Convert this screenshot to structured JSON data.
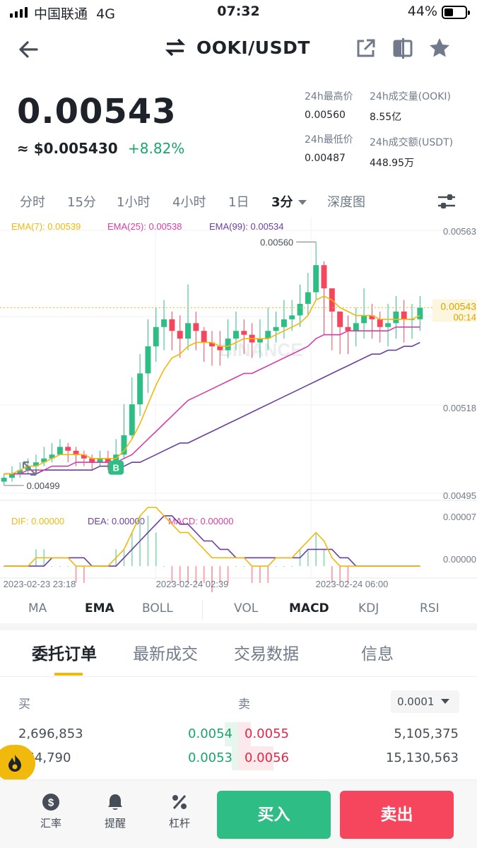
{
  "status_bar": {
    "carrier": "中国联通",
    "network": "4G",
    "time": "07:32",
    "battery": "44%",
    "battery_level": 0.44
  },
  "header": {
    "pair": "OOKI/USDT",
    "icons": [
      "back-arrow-icon",
      "swap-icon",
      "share-icon",
      "split-icon",
      "star-icon"
    ]
  },
  "price": {
    "last": "0.00543",
    "usd": "≈ $0.005430",
    "change": "+8.82%"
  },
  "stats": {
    "high_label": "24h最高价",
    "high": "0.00560",
    "low_label": "24h最低价",
    "low": "0.00487",
    "vol_label": "24h成交量(OOKI)",
    "vol": "8.55亿",
    "amount_label": "24h成交额(USDT)",
    "amount": "448.95万"
  },
  "timeframes": [
    "分时",
    "15分",
    "1小时",
    "4小时",
    "1日",
    "3分",
    "深度图"
  ],
  "active_timeframe": "3分",
  "indicator_tabs": {
    "main": [
      "MA",
      "EMA",
      "BOLL"
    ],
    "sub": [
      "VOL",
      "MACD",
      "KDJ",
      "RSI"
    ],
    "active_main": "EMA",
    "active_sub": "MACD"
  },
  "book_tabs": [
    "委托订单",
    "最新成交",
    "交易数据",
    "信息"
  ],
  "order_book": {
    "buy_label": "买",
    "sell_label": "卖",
    "precision": "0.0001",
    "rows": [
      {
        "buy_qty": "2,696,853",
        "buy_price": "0.0054",
        "sell_price": "0.0055",
        "sell_qty": "5,105,375"
      },
      {
        "buy_qty": "864,790",
        "buy_price": "0.0053",
        "sell_price": "0.0056",
        "sell_qty": "15,130,563"
      }
    ]
  },
  "bottom_nav": [
    {
      "label": "汇率",
      "icon": "dollar-icon"
    },
    {
      "label": "提醒",
      "icon": "bell-icon"
    },
    {
      "label": "杠杆",
      "icon": "percent-icon"
    }
  ],
  "actions": {
    "buy": "买入",
    "sell": "卖出"
  },
  "colors": {
    "up": "#2ebd85",
    "down": "#f6465d",
    "ema7": "#f0b90b",
    "ema25": "#d63ea8",
    "ema99": "#6b3fa0",
    "accent": "#f0b90b"
  },
  "chart_data": {
    "type": "candlestick",
    "ema_legend": [
      "EMA(7): 0.00539",
      "EMA(25): 0.00538",
      "EMA(99): 0.00534"
    ],
    "price_axis": [
      "0.00563",
      "0.00518",
      "0.00495"
    ],
    "last_price_tag": "0.00543",
    "countdown": "00:14",
    "high_marker": "0.00560",
    "low_marker": "0.00499",
    "buy_marker": "B",
    "macd_legend": [
      "DIF: 0.00000",
      "DEA: 0.00000",
      "MACD: 0.00000"
    ],
    "macd_axis": [
      "0.00007",
      "0.00000"
    ],
    "time_axis": [
      "2023-02-23 23:18",
      "2023-02-24 02:39",
      "2023-02-24 06:00"
    ],
    "ylim": [
      0.00495,
      0.00563
    ],
    "close": [
      0.00499,
      0.005,
      0.00501,
      0.00502,
      0.00503,
      0.00504,
      0.00505,
      0.00507,
      0.00506,
      0.00505,
      0.00504,
      0.00503,
      0.00504,
      0.00503,
      0.00505,
      0.0051,
      0.00518,
      0.00526,
      0.00533,
      0.00538,
      0.0054,
      0.00537,
      0.00535,
      0.00539,
      0.00537,
      0.00534,
      0.00533,
      0.00532,
      0.00535,
      0.00537,
      0.00536,
      0.00534,
      0.00535,
      0.00537,
      0.00538,
      0.0054,
      0.00541,
      0.00544,
      0.00547,
      0.00554,
      0.00548,
      0.00542,
      0.00538,
      0.00537,
      0.00539,
      0.00541,
      0.0054,
      0.00538,
      0.00539,
      0.00542,
      0.0054,
      0.0054,
      0.00543
    ],
    "high": [
      0.005,
      0.00502,
      0.00503,
      0.00504,
      0.00505,
      0.00507,
      0.00508,
      0.00509,
      0.00508,
      0.00507,
      0.00506,
      0.00505,
      0.00506,
      0.00506,
      0.00509,
      0.00518,
      0.00525,
      0.00531,
      0.0054,
      0.00543,
      0.00545,
      0.00542,
      0.00541,
      0.00549,
      0.00542,
      0.00538,
      0.00537,
      0.00537,
      0.0054,
      0.00542,
      0.0054,
      0.00539,
      0.0054,
      0.00543,
      0.00542,
      0.00545,
      0.00545,
      0.00549,
      0.00552,
      0.0056,
      0.00555,
      0.00546,
      0.00542,
      0.00541,
      0.00543,
      0.00548,
      0.00544,
      0.00542,
      0.00544,
      0.00546,
      0.00545,
      0.00544,
      0.00546
    ],
    "low": [
      0.00497,
      0.00498,
      0.00499,
      0.005,
      0.00501,
      0.00502,
      0.00503,
      0.00505,
      0.00503,
      0.00502,
      0.00502,
      0.00501,
      0.00502,
      0.00501,
      0.00502,
      0.00504,
      0.00509,
      0.00515,
      0.00521,
      0.00529,
      0.00532,
      0.00532,
      0.0053,
      0.00532,
      0.00532,
      0.00529,
      0.00528,
      0.00528,
      0.0053,
      0.00532,
      0.00531,
      0.0053,
      0.0053,
      0.00532,
      0.00534,
      0.00535,
      0.00537,
      0.00538,
      0.00541,
      0.00545,
      0.00536,
      0.00532,
      0.00531,
      0.00531,
      0.00533,
      0.00535,
      0.00535,
      0.00534,
      0.00533,
      0.00535,
      0.00534,
      0.00535,
      0.00537
    ],
    "ema7": [
      0.005,
      0.005,
      0.00501,
      0.00502,
      0.00502,
      0.00503,
      0.00504,
      0.00505,
      0.00505,
      0.00505,
      0.00505,
      0.00504,
      0.00504,
      0.00504,
      0.00504,
      0.00506,
      0.00509,
      0.00513,
      0.00518,
      0.00523,
      0.00527,
      0.0053,
      0.00531,
      0.00533,
      0.00534,
      0.00534,
      0.00534,
      0.00533,
      0.00533,
      0.00534,
      0.00535,
      0.00535,
      0.00535,
      0.00535,
      0.00536,
      0.00537,
      0.00538,
      0.00539,
      0.00541,
      0.00545,
      0.00546,
      0.00545,
      0.00543,
      0.00542,
      0.00541,
      0.00541,
      0.00541,
      0.0054,
      0.0054,
      0.0054,
      0.0054,
      0.0054,
      0.00541
    ],
    "ema25": [
      0.005,
      0.005,
      0.005,
      0.00501,
      0.00501,
      0.00501,
      0.00502,
      0.00502,
      0.00502,
      0.00503,
      0.00503,
      0.00503,
      0.00503,
      0.00503,
      0.00503,
      0.00504,
      0.00505,
      0.00507,
      0.00509,
      0.00511,
      0.00513,
      0.00515,
      0.00517,
      0.00519,
      0.0052,
      0.00521,
      0.00522,
      0.00523,
      0.00524,
      0.00525,
      0.00526,
      0.00526,
      0.00527,
      0.00528,
      0.00529,
      0.0053,
      0.00531,
      0.00532,
      0.00533,
      0.00535,
      0.00536,
      0.00536,
      0.00536,
      0.00537,
      0.00537,
      0.00537,
      0.00537,
      0.00537,
      0.00537,
      0.00538,
      0.00538,
      0.00538,
      0.00538
    ],
    "ema99": [
      0.005,
      0.005,
      0.005,
      0.005,
      0.005,
      0.00501,
      0.00501,
      0.00501,
      0.00501,
      0.00501,
      0.00501,
      0.00501,
      0.00502,
      0.00502,
      0.00502,
      0.00502,
      0.00503,
      0.00503,
      0.00504,
      0.00505,
      0.00506,
      0.00507,
      0.00508,
      0.00508,
      0.00509,
      0.0051,
      0.00511,
      0.00512,
      0.00513,
      0.00514,
      0.00515,
      0.00516,
      0.00517,
      0.00518,
      0.00519,
      0.0052,
      0.00521,
      0.00522,
      0.00523,
      0.00524,
      0.00525,
      0.00526,
      0.00527,
      0.00528,
      0.00529,
      0.0053,
      0.00531,
      0.00531,
      0.00532,
      0.00532,
      0.00533,
      0.00533,
      0.00534
    ],
    "dif": [
      0.0,
      0.0,
      0.0,
      0.0,
      1e-05,
      1e-05,
      1e-05,
      1e-05,
      1e-05,
      0.0,
      0.0,
      0.0,
      0.0,
      0.0,
      1e-05,
      2e-05,
      4e-05,
      6e-05,
      7e-05,
      7e-05,
      6e-05,
      5e-05,
      4e-05,
      4e-05,
      3e-05,
      2e-05,
      1e-05,
      1e-05,
      1e-05,
      1e-05,
      1e-05,
      0.0,
      0.0,
      0.0,
      1e-05,
      1e-05,
      1e-05,
      2e-05,
      3e-05,
      4e-05,
      3e-05,
      1e-05,
      0.0,
      0.0,
      0.0,
      0.0,
      0.0,
      0.0,
      0.0,
      0.0,
      0.0,
      0.0,
      0.0
    ],
    "dea": [
      0.0,
      0.0,
      0.0,
      0.0,
      0.0,
      0.0,
      1e-05,
      1e-05,
      1e-05,
      1e-05,
      1e-05,
      0.0,
      0.0,
      0.0,
      0.0,
      1e-05,
      2e-05,
      3e-05,
      4e-05,
      5e-05,
      6e-05,
      6e-05,
      5e-05,
      5e-05,
      4e-05,
      3e-05,
      3e-05,
      2e-05,
      2e-05,
      1e-05,
      1e-05,
      1e-05,
      1e-05,
      1e-05,
      1e-05,
      1e-05,
      1e-05,
      1e-05,
      2e-05,
      2e-05,
      2e-05,
      2e-05,
      1e-05,
      1e-05,
      0.0,
      0.0,
      0.0,
      0.0,
      0.0,
      0.0,
      0.0,
      0.0,
      0.0
    ],
    "macd_ylim": [
      -1e-05,
      7e-05
    ]
  }
}
